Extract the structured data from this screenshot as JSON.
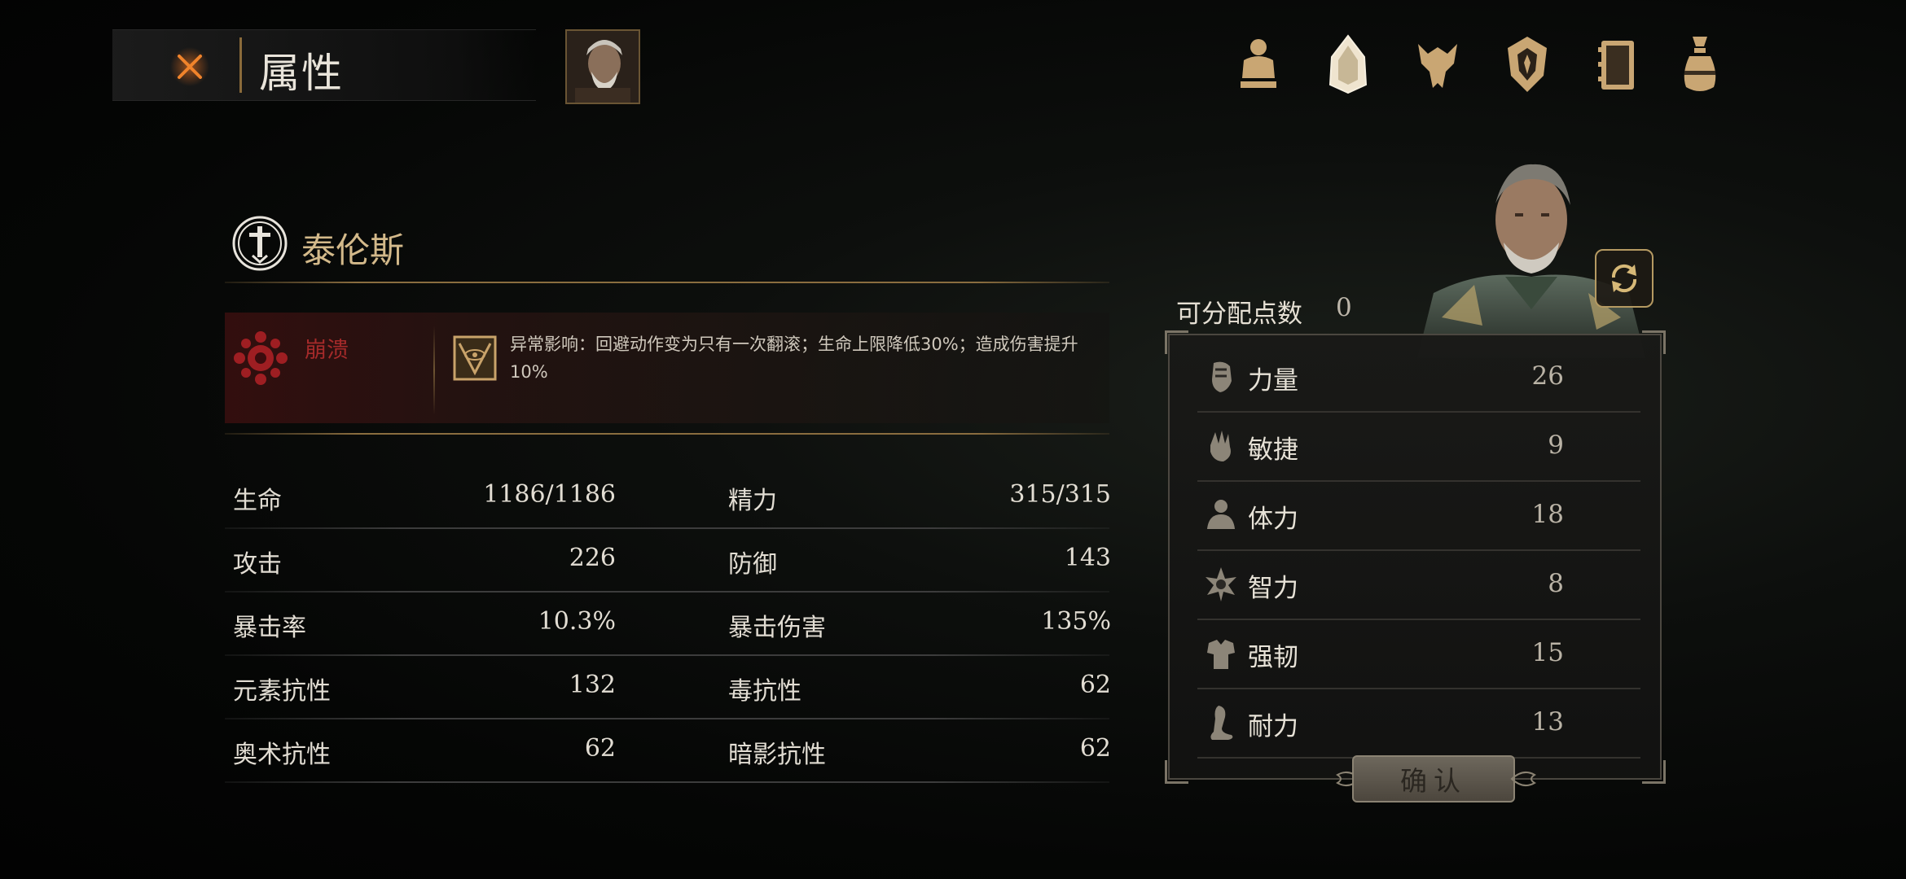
{
  "header": {
    "title": "属性",
    "close_icon": "close-x-icon"
  },
  "nav": {
    "icons": [
      "character-icon",
      "helmet-icon",
      "beast-icon",
      "crest-icon",
      "journal-icon",
      "bag-icon"
    ]
  },
  "character": {
    "name": "泰伦斯",
    "class_icon": "sword-emblem-icon"
  },
  "status": {
    "name": "崩溃",
    "description": "异常影响：回避动作变为只有一次翻滚；生命上限降低30%；造成伤害提升10%",
    "colors": {
      "status_red": "#a42a2a"
    }
  },
  "stats": [
    {
      "left_label": "生命",
      "left_value": "1186/1186",
      "right_label": "精力",
      "right_value": "315/315"
    },
    {
      "left_label": "攻击",
      "left_value": "226",
      "right_label": "防御",
      "right_value": "143"
    },
    {
      "left_label": "暴击率",
      "left_value": "10.3%",
      "right_label": "暴击伤害",
      "right_value": "135%"
    },
    {
      "left_label": "元素抗性",
      "left_value": "132",
      "right_label": "毒抗性",
      "right_value": "62"
    },
    {
      "left_label": "奥术抗性",
      "left_value": "62",
      "right_label": "暗影抗性",
      "right_value": "62"
    }
  ],
  "attributes": {
    "points_label": "可分配点数",
    "points_value": "0",
    "items": [
      {
        "icon": "fist-icon",
        "label": "力量",
        "value": "26"
      },
      {
        "icon": "hand-icon",
        "label": "敏捷",
        "value": "9"
      },
      {
        "icon": "body-icon",
        "label": "体力",
        "value": "18"
      },
      {
        "icon": "mind-icon",
        "label": "智力",
        "value": "8"
      },
      {
        "icon": "armor-icon",
        "label": "强韧",
        "value": "15"
      },
      {
        "icon": "leg-icon",
        "label": "耐力",
        "value": "13"
      }
    ],
    "confirm_label": "确认"
  },
  "colors": {
    "gold": "#d3b98a",
    "accent_line": "#8a6d3f"
  }
}
